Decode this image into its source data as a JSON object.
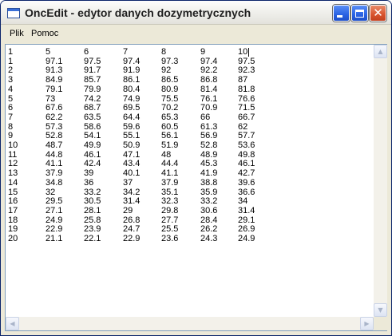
{
  "window": {
    "title": "OncEdit - edytor danych dozymetrycznych",
    "icons": {
      "app": "app-icon",
      "minimize": "minimize-icon",
      "maximize": "maximize-icon",
      "close": "close-icon"
    },
    "close_glyph": "✕"
  },
  "menu": {
    "items": [
      "Plik",
      "Pomoc"
    ]
  },
  "editor": {
    "rows": [
      [
        "1",
        "5",
        "6",
        "7",
        "8",
        "9",
        "10"
      ],
      [
        "1",
        "97.1",
        "97.5",
        "97.4",
        "97.3",
        "97.4",
        "97.5"
      ],
      [
        "2",
        "91.3",
        "91.7",
        "91.9",
        "92",
        "92.2",
        "92.3"
      ],
      [
        "3",
        "84.9",
        "85.7",
        "86.1",
        "86.5",
        "86.8",
        "87"
      ],
      [
        "4",
        "79.1",
        "79.9",
        "80.4",
        "80.9",
        "81.4",
        "81.8"
      ],
      [
        "5",
        "73",
        "74.2",
        "74.9",
        "75.5",
        "76.1",
        "76.6"
      ],
      [
        "6",
        "67.6",
        "68.7",
        "69.5",
        "70.2",
        "70.9",
        "71.5"
      ],
      [
        "7",
        "62.2",
        "63.5",
        "64.4",
        "65.3",
        "66",
        "66.7"
      ],
      [
        "8",
        "57.3",
        "58.6",
        "59.6",
        "60.5",
        "61.3",
        "62"
      ],
      [
        "9",
        "52.8",
        "54.1",
        "55.1",
        "56.1",
        "56.9",
        "57.7"
      ],
      [
        "10",
        "48.7",
        "49.9",
        "50.9",
        "51.9",
        "52.8",
        "53.6"
      ],
      [
        "11",
        "44.8",
        "46.1",
        "47.1",
        "48",
        "48.9",
        "49.8"
      ],
      [
        "12",
        "41.1",
        "42.4",
        "43.4",
        "44.4",
        "45.3",
        "46.1"
      ],
      [
        "13",
        "37.9",
        "39",
        "40.1",
        "41.1",
        "41.9",
        "42.7"
      ],
      [
        "14",
        "34.8",
        "36",
        "37",
        "37.9",
        "38.8",
        "39.6"
      ],
      [
        "15",
        "32",
        "33.2",
        "34.2",
        "35.1",
        "35.9",
        "36.6"
      ],
      [
        "16",
        "29.5",
        "30.5",
        "31.4",
        "32.3",
        "33.2",
        "34"
      ],
      [
        "17",
        "27.1",
        "28.1",
        "29",
        "29.8",
        "30.6",
        "31.4"
      ],
      [
        "18",
        "24.9",
        "25.8",
        "26.8",
        "27.7",
        "28.4",
        "29.1"
      ],
      [
        "19",
        "22.9",
        "23.9",
        "24.7",
        "25.5",
        "26.2",
        "26.9"
      ],
      [
        "20",
        "21.1",
        "22.1",
        "22.9",
        "23.6",
        "24.3",
        "24.9"
      ]
    ]
  },
  "scrollbars": {
    "up_glyph": "▲",
    "down_glyph": "▼",
    "left_glyph": "◀",
    "right_glyph": "▶"
  },
  "colors": {
    "titlebar": "#f2f2ee",
    "window_button": "#2a62e4",
    "close_button": "#d8532d",
    "editor_border": "#7f9db9"
  }
}
